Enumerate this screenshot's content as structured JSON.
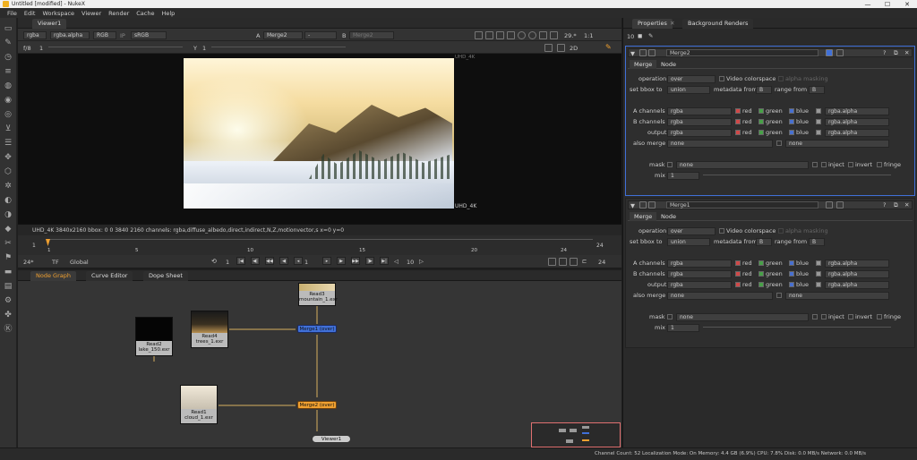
{
  "titlebar": {
    "title": "Untitled [modified] - NukeX",
    "min": "—",
    "max": "☐",
    "close": "✕"
  },
  "menu": [
    "File",
    "Edit",
    "Workspace",
    "Viewer",
    "Render",
    "Cache",
    "Help"
  ],
  "viewer": {
    "tab_label": "Viewer1",
    "ctl1": {
      "channels": "rgba",
      "alpha": "rgba.alpha",
      "colorspace_a": "RGB",
      "ip": "IP",
      "colorspace_b": "sRGB",
      "a_label": "A",
      "a_input": "Merge2",
      "dash": "-",
      "b_label": "B",
      "b_input": "Merge2",
      "fps": "29.*",
      "zoom": "1:1"
    },
    "ctl2": {
      "fstop": "f/8",
      "gain": "1",
      "y_label": "Y",
      "gamma": "1",
      "mode": "2D"
    },
    "format_label_top": "UHD_4K",
    "format_label_bottom": "UHD_4K"
  },
  "infobar": {
    "text": "UHD_4K 3840x2160   bbox: 0 0 3840 2160 channels: rgba,diffuse_albedo,direct,indirect,N,Z,motionvector,s  x=0 y=0"
  },
  "timeline": {
    "ticks": [
      "1",
      "5",
      "10",
      "15",
      "20",
      "24"
    ],
    "end_frame": "24",
    "current": "1"
  },
  "playbar": {
    "fps": "24*",
    "tf": "TF",
    "global": "Global",
    "frame": "1",
    "skip": "10",
    "end": "24",
    "step": "1"
  },
  "nodegraph": {
    "tabs": [
      "Node Graph",
      "Curve Editor",
      "Dope Sheet"
    ],
    "nodes": {
      "read3": {
        "name": "Read3",
        "file": "mountain_1.exr"
      },
      "read4": {
        "name": "Read4",
        "file": "trees_1.exr"
      },
      "read2": {
        "name": "Read2",
        "file": "lake_150.exr"
      },
      "read1": {
        "name": "Read1",
        "file": "cloud_1.exr"
      },
      "merge1": "Merge1 (over)",
      "merge2": "Merge2 (over)",
      "viewer1": "Viewer1"
    }
  },
  "statusbar": {
    "text": "Channel Count: 52  Localization Mode: On  Memory: 4.4 GB (6.9%)  CPU: 7.8%  Disk: 0.0 MB/s  Network: 0.0 MB/s"
  },
  "properties": {
    "tabs": [
      "Properties",
      "Background Renders"
    ],
    "count": "10",
    "panels": [
      {
        "name": "Merge2",
        "tabs": [
          "Merge",
          "Node"
        ],
        "operation_label": "operation",
        "operation": "over",
        "video_colorspace": "Video colorspace",
        "alpha_masking": "alpha masking",
        "bbox_label": "set bbox to",
        "bbox": "union",
        "metadata_label": "metadata from",
        "metadata": "B",
        "range_label": "range from",
        "range": "B",
        "a_label": "A channels",
        "a_val": "rgba",
        "a_alpha": "rgba.alpha",
        "b_label": "B channels",
        "b_val": "rgba",
        "b_alpha": "rgba.alpha",
        "out_label": "output",
        "out_val": "rgba",
        "out_alpha": "rgba.alpha",
        "also_label": "also merge",
        "also_a": "none",
        "also_b": "none",
        "red": "red",
        "green": "green",
        "blue": "blue",
        "mask_label": "mask",
        "mask": "none",
        "inject": "inject",
        "invert": "invert",
        "fringe": "fringe",
        "mix_label": "mix",
        "mix": "1"
      },
      {
        "name": "Merge1",
        "tabs": [
          "Merge",
          "Node"
        ],
        "operation_label": "operation",
        "operation": "over",
        "video_colorspace": "Video colorspace",
        "alpha_masking": "alpha masking",
        "bbox_label": "set bbox to",
        "bbox": "union",
        "metadata_label": "metadata from",
        "metadata": "B",
        "range_label": "range from",
        "range": "B",
        "a_label": "A channels",
        "a_val": "rgba",
        "a_alpha": "rgba.alpha",
        "b_label": "B channels",
        "b_val": "rgba",
        "b_alpha": "rgba.alpha",
        "out_label": "output",
        "out_val": "rgba",
        "out_alpha": "rgba.alpha",
        "also_label": "also merge",
        "also_a": "none",
        "also_b": "none",
        "red": "red",
        "green": "green",
        "blue": "blue",
        "mask_label": "mask",
        "mask": "none",
        "inject": "inject",
        "invert": "invert",
        "fringe": "fringe",
        "mix_label": "mix",
        "mix": "1"
      }
    ]
  },
  "colors": {
    "accent": "#f0a030",
    "merge_selected": "#4070d8",
    "merge2": "#f0a030",
    "bg": "#1e1e1e"
  }
}
